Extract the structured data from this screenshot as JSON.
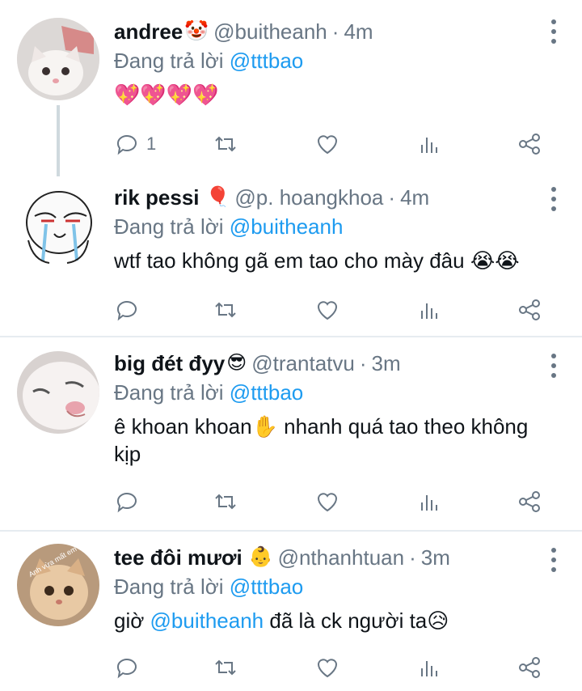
{
  "tweets": [
    {
      "name": "andree",
      "name_emoji": "🤡",
      "handle": "@buitheanh",
      "time": "4m",
      "replying_prefix": "Đang trả lời",
      "replying_to": "@tttbao",
      "text": "💖💖💖💖",
      "reply_count": "1"
    },
    {
      "name": "rik pessi",
      "name_emoji": "🎈",
      "handle": "@p. hoangkhoa",
      "time": "4m",
      "replying_prefix": "Đang trả lời",
      "replying_to": "@buitheanh",
      "text": "wtf tao không gã em tao cho mày đâu 😭😭",
      "reply_count": ""
    },
    {
      "name": "big đét đyy",
      "name_emoji": "😎",
      "handle": "@trantatvu",
      "time": "3m",
      "replying_prefix": "Đang trả lời",
      "replying_to": "@tttbao",
      "text": "ê khoan khoan✋ nhanh quá tao theo không kịp",
      "reply_count": ""
    },
    {
      "name": "tee đôi mươi",
      "name_emoji": "👶",
      "handle": "@nthanhtuan",
      "time": "3m",
      "replying_prefix": "Đang trả lời",
      "replying_to": "@tttbao",
      "text_mention": "@buitheanh",
      "text_after": " đã là ck người ta😥",
      "text_before": "giờ ",
      "reply_count": "",
      "avatar_caption": "Anh vừa mất em hả"
    }
  ],
  "separator": "·",
  "colors": {
    "mention": "#1d9bf0",
    "secondary": "#687684",
    "thread_line": "#cfd9de"
  }
}
